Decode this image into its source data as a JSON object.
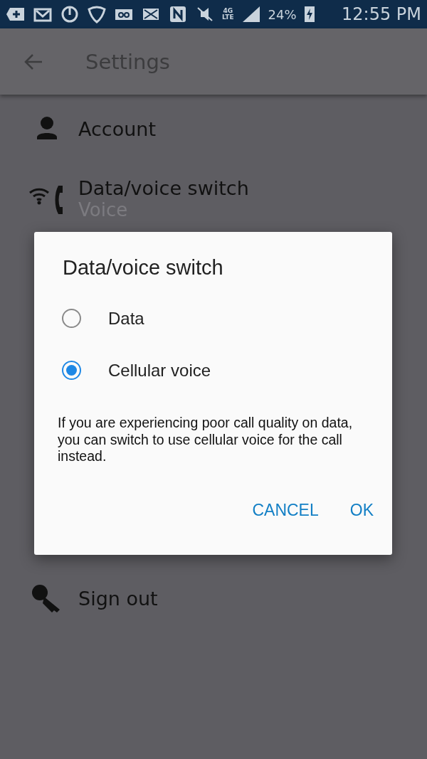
{
  "status_bar": {
    "network_type": "4G",
    "network_sub": "LTE",
    "battery": "24%",
    "time": "12:55 PM"
  },
  "app_bar": {
    "title": "Settings"
  },
  "settings": [
    {
      "kind": "account",
      "title": "Account"
    },
    {
      "kind": "switch",
      "title": "Data/voice switch",
      "subtitle": "Voice"
    },
    {
      "kind": "signout",
      "title": "Sign out"
    }
  ],
  "dialog": {
    "title": "Data/voice switch",
    "options": [
      {
        "label": "Data",
        "selected": false
      },
      {
        "label": "Cellular voice",
        "selected": true
      }
    ],
    "message": "If you are experiencing poor call quality on data, you can switch to use cellular voice for the call instead.",
    "buttons": [
      "CANCEL",
      "OK"
    ]
  }
}
